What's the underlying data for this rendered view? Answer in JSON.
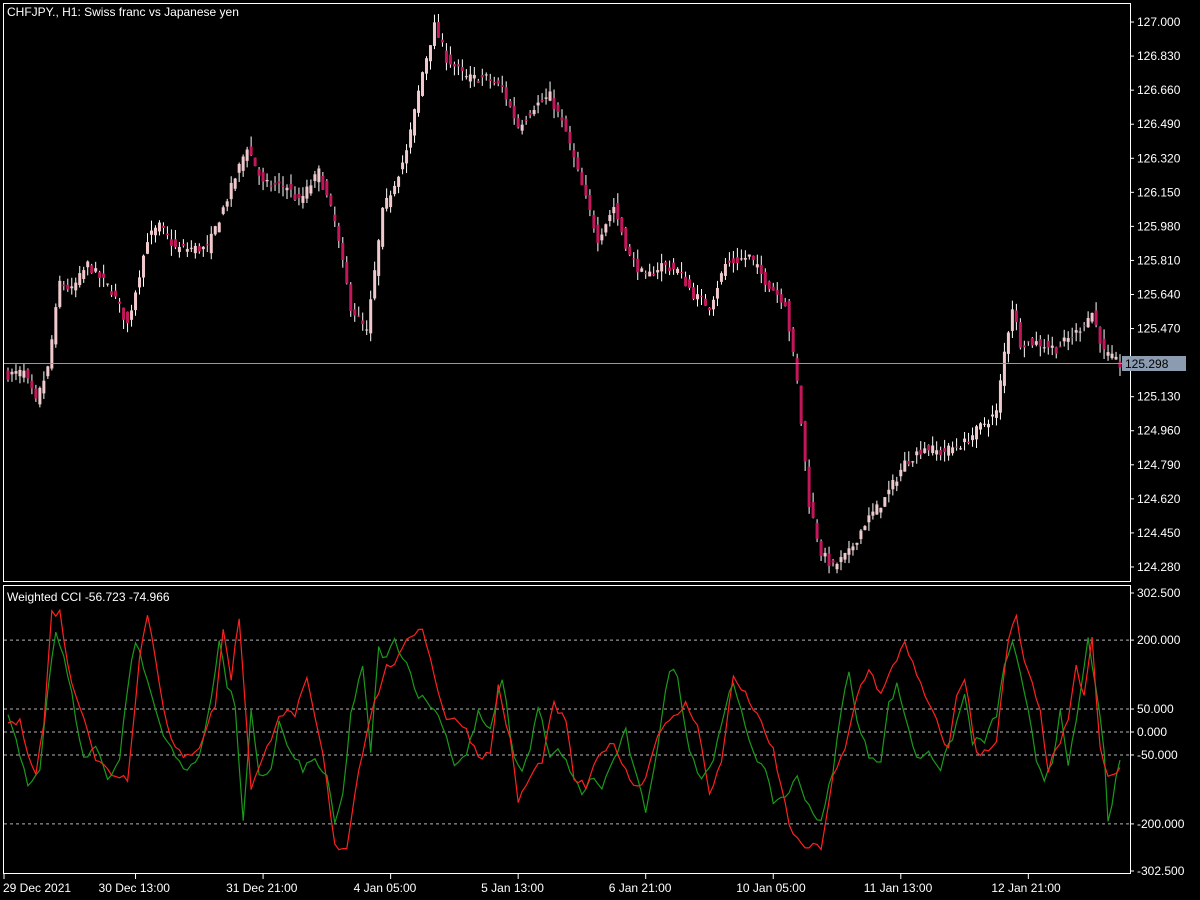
{
  "colors": {
    "background": "#000000",
    "frame": "#ffffff",
    "bull_candle": "#f0c9cc",
    "bear_candle": "#c2185b",
    "wick": "#ffffff",
    "last_price_line": "#8c9bb0",
    "last_price_box": "#8c9bb0",
    "cci_fast": "#ff2020",
    "cci_slow": "#1a9a1a",
    "level_line": "#b4b4b4"
  },
  "main_panel": {
    "title": "CHFJPY., H1:  Swiss franc vs Japanese yen",
    "last_price_label": "125.298"
  },
  "indicator_panel": {
    "title": "Weighted CCI -56.723 -74.966"
  },
  "chart_data": [
    {
      "type": "candlestick",
      "symbol": "CHFJPY.",
      "timeframe": "H1",
      "ylim": [
        124.21,
        127.09
      ],
      "y_ticks": [
        "127.000",
        "126.830",
        "126.660",
        "126.490",
        "126.320",
        "126.150",
        "125.980",
        "125.810",
        "125.640",
        "125.470",
        "125.130",
        "124.960",
        "124.790",
        "124.620",
        "124.450",
        "124.280"
      ],
      "last_price": 125.298,
      "x_ticks": [
        "29 Dec 2021",
        "30 Dec 13:00",
        "31 Dec 21:00",
        "4 Jan 05:00",
        "5 Jan 13:00",
        "6 Jan 21:00",
        "10 Jan 05:00",
        "11 Jan 13:00",
        "12 Jan 21:00"
      ],
      "x_tick_bar_index": [
        0,
        32,
        64,
        96,
        128,
        160,
        192,
        224,
        256
      ],
      "bar_count": 280,
      "anchors": [
        [
          0,
          125.24
        ],
        [
          4,
          125.25
        ],
        [
          7,
          125.1
        ],
        [
          10,
          125.27
        ],
        [
          13,
          125.7
        ],
        [
          16,
          125.66
        ],
        [
          20,
          125.79
        ],
        [
          26,
          125.66
        ],
        [
          30,
          125.49
        ],
        [
          35,
          125.92
        ],
        [
          38,
          125.98
        ],
        [
          42,
          125.87
        ],
        [
          50,
          125.87
        ],
        [
          55,
          126.12
        ],
        [
          60,
          126.38
        ],
        [
          64,
          126.19
        ],
        [
          70,
          126.18
        ],
        [
          73,
          126.1
        ],
        [
          78,
          126.25
        ],
        [
          82,
          126.0
        ],
        [
          86,
          125.58
        ],
        [
          90,
          125.45
        ],
        [
          94,
          126.05
        ],
        [
          100,
          126.35
        ],
        [
          104,
          126.75
        ],
        [
          107,
          126.98
        ],
        [
          110,
          126.82
        ],
        [
          115,
          126.72
        ],
        [
          120,
          126.72
        ],
        [
          124,
          126.67
        ],
        [
          128,
          126.48
        ],
        [
          132,
          126.58
        ],
        [
          136,
          126.63
        ],
        [
          140,
          126.45
        ],
        [
          144,
          126.18
        ],
        [
          148,
          125.92
        ],
        [
          152,
          126.08
        ],
        [
          156,
          125.83
        ],
        [
          160,
          125.72
        ],
        [
          164,
          125.79
        ],
        [
          168,
          125.76
        ],
        [
          172,
          125.64
        ],
        [
          176,
          125.58
        ],
        [
          180,
          125.79
        ],
        [
          186,
          125.83
        ],
        [
          190,
          125.71
        ],
        [
          195,
          125.6
        ],
        [
          198,
          125.2
        ],
        [
          201,
          124.6
        ],
        [
          204,
          124.35
        ],
        [
          207,
          124.28
        ],
        [
          211,
          124.35
        ],
        [
          215,
          124.5
        ],
        [
          220,
          124.62
        ],
        [
          225,
          124.8
        ],
        [
          230,
          124.88
        ],
        [
          234,
          124.85
        ],
        [
          240,
          124.9
        ],
        [
          244,
          124.98
        ],
        [
          248,
          125.05
        ],
        [
          250,
          125.35
        ],
        [
          252,
          125.58
        ],
        [
          254,
          125.4
        ],
        [
          258,
          125.4
        ],
        [
          263,
          125.37
        ],
        [
          268,
          125.45
        ],
        [
          272,
          125.55
        ],
        [
          275,
          125.35
        ],
        [
          279,
          125.29
        ]
      ]
    },
    {
      "type": "line",
      "name": "Weighted CCI",
      "values_last": [
        -56.723,
        -74.966
      ],
      "ylim": [
        -302.5,
        302.5
      ],
      "y_ticks": [
        "302.500",
        "200.000",
        "50.000",
        "0.000",
        "-50.000",
        "-200.000",
        "-302.500"
      ],
      "levels": [
        200,
        50,
        0,
        -50,
        -200
      ],
      "bar_count": 280,
      "series": [
        {
          "color": "#ff2020",
          "anchors": [
            [
              0,
              20
            ],
            [
              3,
              20
            ],
            [
              5,
              -40
            ],
            [
              7,
              -90
            ],
            [
              9,
              20
            ],
            [
              11,
              260
            ],
            [
              13,
              260
            ],
            [
              16,
              100
            ],
            [
              19,
              40
            ],
            [
              22,
              -60
            ],
            [
              26,
              -90
            ],
            [
              30,
              -100
            ],
            [
              33,
              160
            ],
            [
              35,
              260
            ],
            [
              37,
              160
            ],
            [
              39,
              60
            ],
            [
              41,
              -20
            ],
            [
              44,
              -60
            ],
            [
              48,
              -30
            ],
            [
              52,
              60
            ],
            [
              54,
              220
            ],
            [
              56,
              120
            ],
            [
              58,
              250
            ],
            [
              61,
              -120
            ],
            [
              64,
              -60
            ],
            [
              68,
              40
            ],
            [
              72,
              40
            ],
            [
              75,
              110
            ],
            [
              79,
              -50
            ],
            [
              82,
              -250
            ],
            [
              85,
              -250
            ],
            [
              88,
              -80
            ],
            [
              91,
              40
            ],
            [
              95,
              140
            ],
            [
              98,
              160
            ],
            [
              101,
              210
            ],
            [
              104,
              230
            ],
            [
              107,
              120
            ],
            [
              110,
              30
            ],
            [
              114,
              20
            ],
            [
              118,
              -50
            ],
            [
              121,
              -50
            ],
            [
              123,
              100
            ],
            [
              126,
              -20
            ],
            [
              128,
              -150
            ],
            [
              131,
              -100
            ],
            [
              134,
              -60
            ],
            [
              137,
              60
            ],
            [
              140,
              20
            ],
            [
              142,
              -100
            ],
            [
              145,
              -120
            ],
            [
              148,
              -60
            ],
            [
              151,
              -20
            ],
            [
              154,
              -60
            ],
            [
              157,
              -120
            ],
            [
              160,
              -100
            ],
            [
              163,
              0
            ],
            [
              166,
              20
            ],
            [
              170,
              60
            ],
            [
              173,
              20
            ],
            [
              176,
              -140
            ],
            [
              179,
              -60
            ],
            [
              182,
              120
            ],
            [
              185,
              80
            ],
            [
              188,
              40
            ],
            [
              190,
              -10
            ],
            [
              192,
              -40
            ],
            [
              196,
              -200
            ],
            [
              199,
              -250
            ],
            [
              204,
              -250
            ],
            [
              207,
              -100
            ],
            [
              210,
              -40
            ],
            [
              213,
              80
            ],
            [
              216,
              140
            ],
            [
              219,
              80
            ],
            [
              222,
              140
            ],
            [
              225,
              200
            ],
            [
              228,
              120
            ],
            [
              231,
              60
            ],
            [
              234,
              0
            ],
            [
              236,
              -40
            ],
            [
              238,
              80
            ],
            [
              240,
              120
            ],
            [
              243,
              -50
            ],
            [
              245,
              -40
            ],
            [
              248,
              -20
            ],
            [
              251,
              200
            ],
            [
              253,
              250
            ],
            [
              255,
              150
            ],
            [
              257,
              100
            ],
            [
              259,
              40
            ],
            [
              261,
              -80
            ],
            [
              263,
              -40
            ],
            [
              266,
              20
            ],
            [
              268,
              140
            ],
            [
              270,
              80
            ],
            [
              272,
              200
            ],
            [
              274,
              -40
            ],
            [
              276,
              -100
            ],
            [
              279,
              -80
            ]
          ]
        },
        {
          "color": "#1a9a1a",
          "anchors": [
            [
              0,
              40
            ],
            [
              2,
              -20
            ],
            [
              5,
              -120
            ],
            [
              8,
              -80
            ],
            [
              10,
              100
            ],
            [
              12,
              220
            ],
            [
              14,
              160
            ],
            [
              16,
              80
            ],
            [
              19,
              -60
            ],
            [
              22,
              -30
            ],
            [
              25,
              -100
            ],
            [
              28,
              -60
            ],
            [
              30,
              100
            ],
            [
              32,
              200
            ],
            [
              34,
              140
            ],
            [
              36,
              80
            ],
            [
              38,
              20
            ],
            [
              41,
              -40
            ],
            [
              44,
              -80
            ],
            [
              48,
              -60
            ],
            [
              51,
              80
            ],
            [
              53,
              200
            ],
            [
              55,
              100
            ],
            [
              57,
              60
            ],
            [
              59,
              -200
            ],
            [
              61,
              40
            ],
            [
              63,
              -100
            ],
            [
              66,
              -80
            ],
            [
              68,
              20
            ],
            [
              71,
              -50
            ],
            [
              74,
              -80
            ],
            [
              77,
              -60
            ],
            [
              80,
              -100
            ],
            [
              82,
              -200
            ],
            [
              84,
              -140
            ],
            [
              86,
              40
            ],
            [
              89,
              140
            ],
            [
              91,
              -40
            ],
            [
              93,
              180
            ],
            [
              95,
              160
            ],
            [
              97,
              200
            ],
            [
              100,
              150
            ],
            [
              103,
              80
            ],
            [
              106,
              60
            ],
            [
              109,
              20
            ],
            [
              112,
              -70
            ],
            [
              115,
              -50
            ],
            [
              118,
              40
            ],
            [
              121,
              0
            ],
            [
              124,
              120
            ],
            [
              127,
              -60
            ],
            [
              129,
              -80
            ],
            [
              131,
              -40
            ],
            [
              133,
              60
            ],
            [
              136,
              -60
            ],
            [
              138,
              -40
            ],
            [
              141,
              -80
            ],
            [
              144,
              -140
            ],
            [
              146,
              -100
            ],
            [
              149,
              -120
            ],
            [
              152,
              -60
            ],
            [
              155,
              0
            ],
            [
              157,
              -80
            ],
            [
              160,
              -170
            ],
            [
              163,
              -30
            ],
            [
              166,
              140
            ],
            [
              168,
              120
            ],
            [
              171,
              -40
            ],
            [
              174,
              -100
            ],
            [
              177,
              -60
            ],
            [
              180,
              60
            ],
            [
              182,
              100
            ],
            [
              184,
              40
            ],
            [
              187,
              -40
            ],
            [
              190,
              -90
            ],
            [
              192,
              -150
            ],
            [
              195,
              -140
            ],
            [
              198,
              -100
            ],
            [
              201,
              -160
            ],
            [
              204,
              -200
            ],
            [
              207,
              -80
            ],
            [
              209,
              40
            ],
            [
              211,
              140
            ],
            [
              213,
              20
            ],
            [
              216,
              -50
            ],
            [
              219,
              -60
            ],
            [
              221,
              60
            ],
            [
              223,
              100
            ],
            [
              225,
              40
            ],
            [
              228,
              -60
            ],
            [
              231,
              -40
            ],
            [
              234,
              -80
            ],
            [
              237,
              -10
            ],
            [
              240,
              80
            ],
            [
              242,
              -20
            ],
            [
              245,
              -20
            ],
            [
              248,
              40
            ],
            [
              250,
              140
            ],
            [
              252,
              200
            ],
            [
              254,
              120
            ],
            [
              256,
              40
            ],
            [
              258,
              -60
            ],
            [
              260,
              -100
            ],
            [
              262,
              -60
            ],
            [
              264,
              40
            ],
            [
              266,
              -80
            ],
            [
              269,
              80
            ],
            [
              271,
              200
            ],
            [
              273,
              100
            ],
            [
              275,
              -50
            ],
            [
              276,
              -200
            ],
            [
              279,
              -60
            ]
          ]
        }
      ]
    }
  ]
}
